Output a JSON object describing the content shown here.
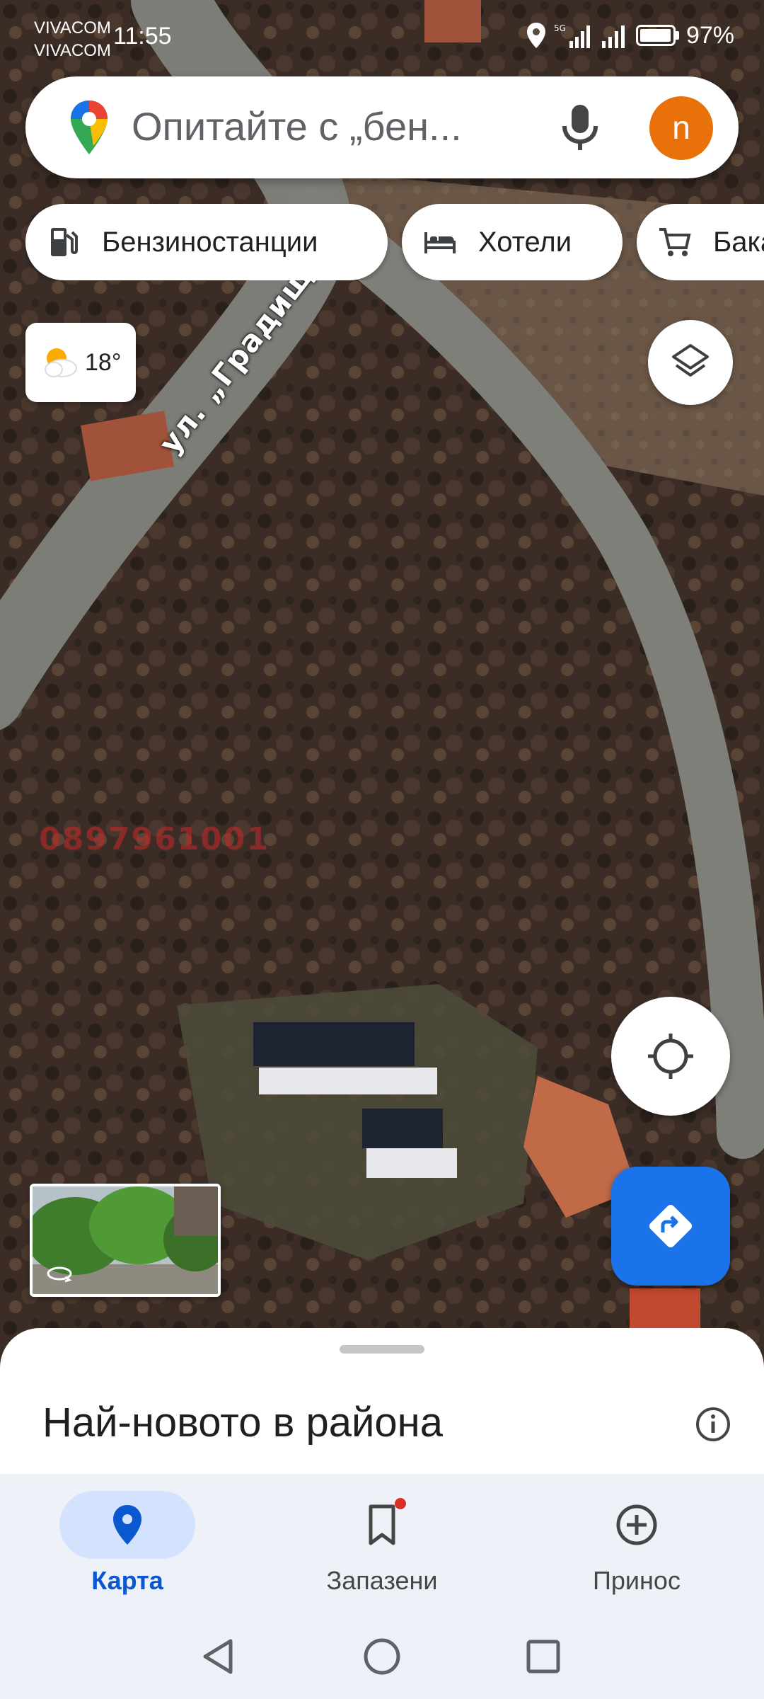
{
  "status_bar": {
    "carrier_1": "VIVACOM",
    "carrier_2": "VIVACOM",
    "time": "11:55",
    "battery": "97%"
  },
  "search": {
    "placeholder": "Опитайте с „бен...",
    "avatar_letter": "n",
    "avatar_color": "#e8710a"
  },
  "chips": [
    {
      "label": "Бензиностанции",
      "icon": "gas-station-icon"
    },
    {
      "label": "Хотели",
      "icon": "bed-icon"
    },
    {
      "label": "Бака",
      "icon": "cart-icon"
    }
  ],
  "weather": {
    "temperature": "18°",
    "icon": "partly-cloudy-icon"
  },
  "map": {
    "street_label": "ул. „Градище“",
    "watermark": "0897961001"
  },
  "sheet": {
    "title": "Най-новото в района"
  },
  "bottom_nav": {
    "items": [
      {
        "label": "Карта",
        "icon": "map-pin-icon",
        "active": true
      },
      {
        "label": "Запазени",
        "icon": "bookmark-icon",
        "active": false
      },
      {
        "label": "Принос",
        "icon": "add-circle-icon",
        "active": false
      }
    ]
  },
  "colors": {
    "accent": "#1a73e8",
    "active_pill": "#d3e3fd",
    "notification_dot": "#d93025"
  }
}
